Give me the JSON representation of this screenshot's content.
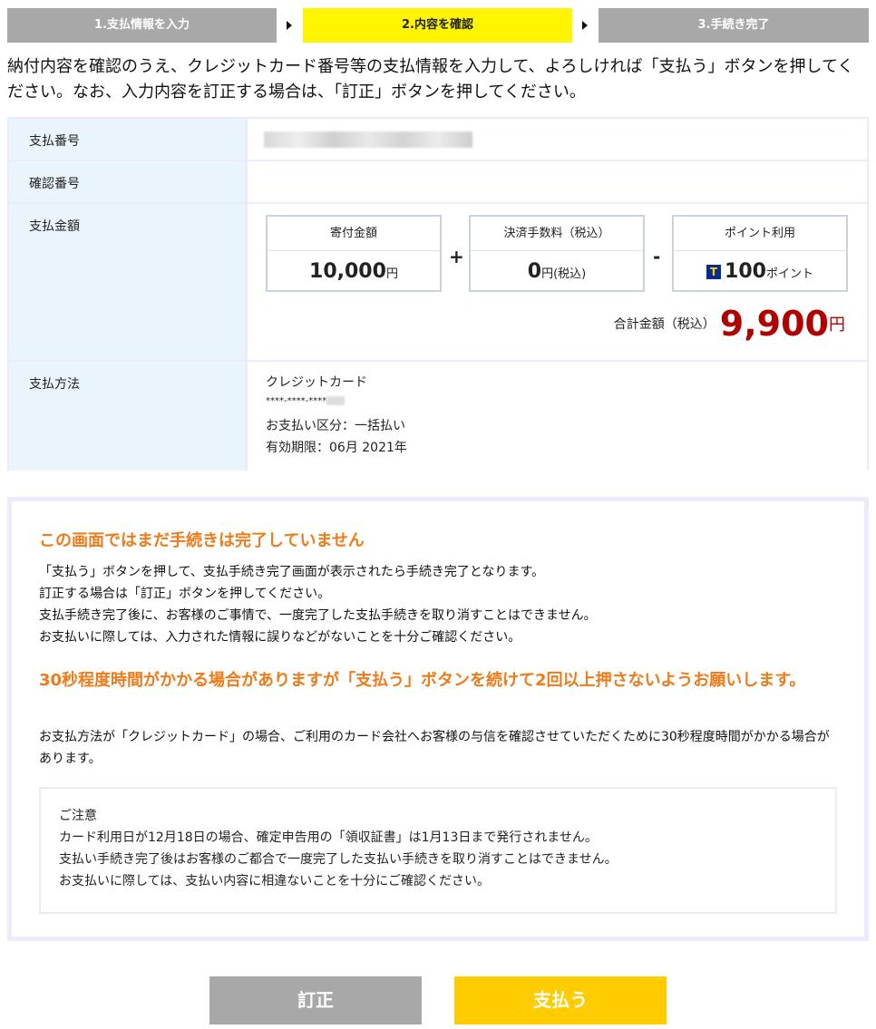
{
  "steps": {
    "step1": "1.支払情報を入力",
    "step2": "2.内容を確認",
    "step3": "3.手続き完了"
  },
  "intro": "納付内容を確認のうえ、クレジットカード番号等の支払情報を入力して、よろしければ「支払う」ボタンを押してください。なお、入力内容を訂正する場合は、「訂正」ボタンを押してください。",
  "table": {
    "payment_number_label": "支払番号",
    "confirmation_number_label": "確認番号",
    "amount_label": "支払金額",
    "method_label": "支払方法"
  },
  "amount": {
    "donation_label": "寄付金額",
    "donation_value": "10,000",
    "donation_unit": "円",
    "fee_label": "決済手数料（税込）",
    "fee_value": "0",
    "fee_unit": "円(税込)",
    "point_label": "ポイント利用",
    "point_icon": "T",
    "point_value": "100",
    "point_unit": "ポイント",
    "plus": "+",
    "minus": "-",
    "total_label": "合計金額（税込）",
    "total_value": "9,900",
    "total_unit": "円"
  },
  "method": {
    "type": "クレジットカード",
    "card_number": "****-****-****",
    "division": "お支払い区分：一括払い",
    "expiry": "有効期限：06月 2021年"
  },
  "notice": {
    "heading1": "この画面ではまだ手続きは完了していません",
    "p1_line1": "「支払う」ボタンを押して、支払手続き完了画面が表示されたら手続き完了となります。",
    "p1_line2": "訂正する場合は「訂正」ボタンを押してください。",
    "p1_line3": "支払手続き完了後に、お客様のご事情で、一度完了した支払手続きを取り消すことはできません。",
    "p1_line4": "お支払いに際しては、入力された情報に誤りなどがないことを十分ご確認ください。",
    "heading2": "30秒程度時間がかかる場合がありますが「支払う」ボタンを続けて2回以上押さないようお願いします。",
    "p2": "お支払方法が「クレジットカード」の場合、ご利用のカード会社へお客様の与信を確認させていただくために30秒程度時間がかかる場合があります。",
    "caution_title": "ご注意",
    "caution_line1": "カード利用日が12月18日の場合、確定申告用の「領収証書」は1月13日まで発行されません。",
    "caution_line2": "支払い手続き完了後はお客様のご都合で一度完了した支払い手続きを取り消すことはできません。",
    "caution_line3": "お支払いに際しては、支払い内容に相違ないことを十分にご確認ください。"
  },
  "buttons": {
    "correct": "訂正",
    "pay": "支払う"
  },
  "colors": {
    "active_step": "#fff500",
    "inactive_step": "#a8a8a8",
    "notice_orange": "#ee7b1a",
    "total_red": "#b00000",
    "pay_button": "#ffcc00"
  }
}
